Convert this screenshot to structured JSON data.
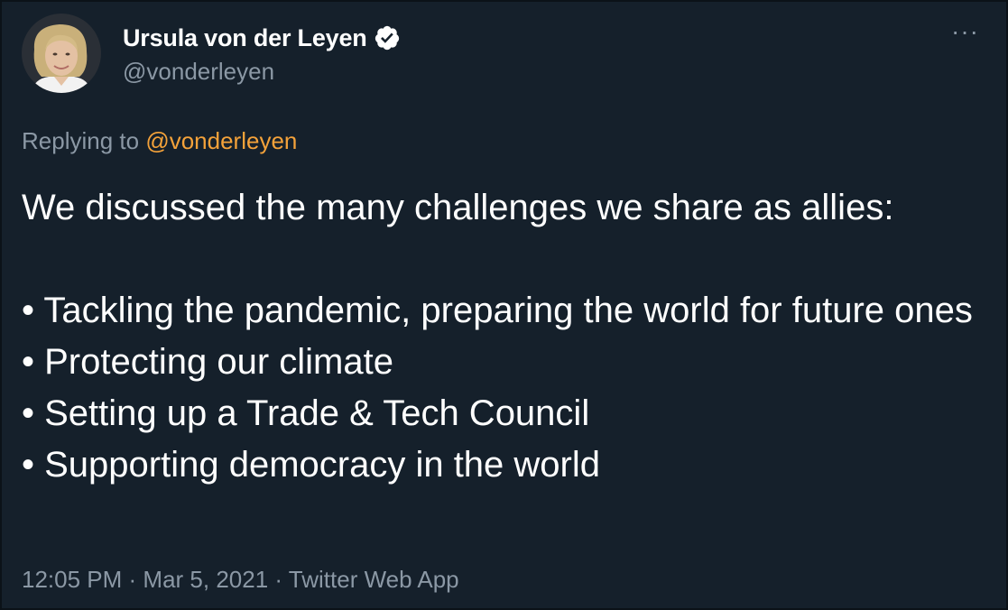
{
  "author": {
    "display_name": "Ursula von der Leyen",
    "handle": "@vonderleyen",
    "verified": true
  },
  "more_icon": "···",
  "reply": {
    "prefix": "Replying to ",
    "mention": "@vonderleyen"
  },
  "tweet": {
    "intro": "We discussed the many challenges we share as allies:",
    "bullets": [
      "• Tackling the pandemic, preparing the world for future ones",
      "• Protecting our climate",
      "• Setting up a Trade & Tech Council",
      "• Supporting democracy in the world"
    ]
  },
  "meta": {
    "time": "12:05 PM",
    "separator": " · ",
    "date": "Mar 5, 2021",
    "source": "Twitter Web App"
  },
  "colors": {
    "background": "#15202b",
    "text": "#ffffff",
    "secondary": "#8b98a5",
    "mention": "#f4a23a"
  },
  "icons": {
    "verified": "verified-badge-icon",
    "more": "more-options-icon"
  }
}
